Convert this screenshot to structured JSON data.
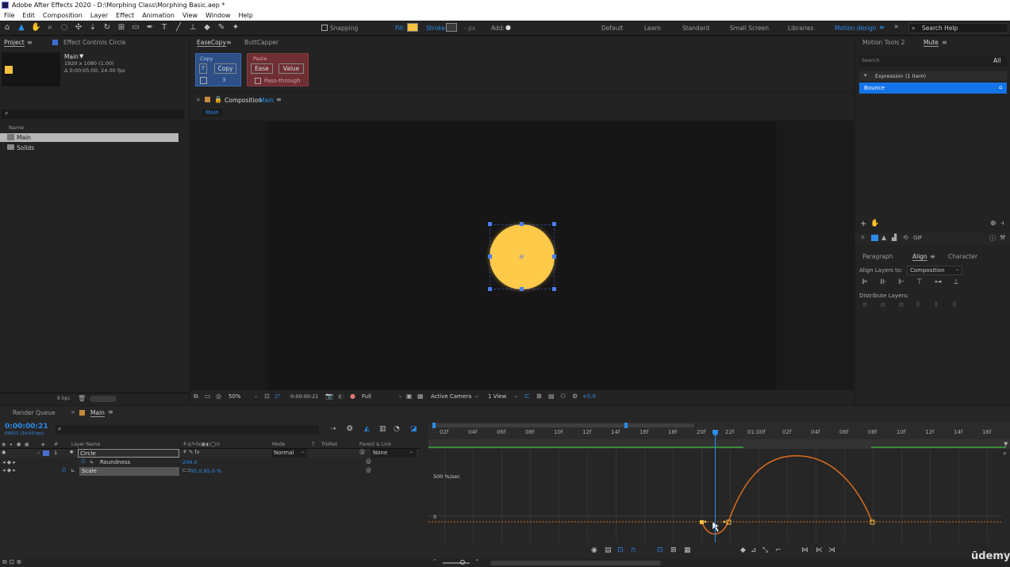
{
  "window": {
    "title": "Adobe After Effects 2020 - D:\\Morphing Class\\Morphing Basic.aep *"
  },
  "menu": [
    "File",
    "Edit",
    "Composition",
    "Layer",
    "Effect",
    "Animation",
    "View",
    "Window",
    "Help"
  ],
  "toolbar": {
    "snapping_label": "Snapping",
    "fill_label": "Fill:",
    "stroke_label": "Stroke:",
    "px_label": "- px",
    "add_label": "Add:",
    "fill_color": "#f5c141",
    "workspaces": [
      "Default",
      "Learn",
      "Standard",
      "Small Screen",
      "Libraries",
      "Motion design"
    ],
    "active_workspace": "Motion design",
    "search_help": "Search Help"
  },
  "project_panel": {
    "tab_project": "Project",
    "tab_effect_controls": "Effect Controls Circle",
    "comp_name": "Main",
    "comp_info_1": "1920 x 1080 (1.00)",
    "comp_info_2": "Δ 0:00:05:00, 24.00 fps",
    "col_name": "Name",
    "items": [
      "Main",
      "Solids"
    ],
    "bpc": "8 bpc"
  },
  "easecopy": {
    "tab_easecopy": "EaseCopy",
    "tab_buttcapper": "ButtCapper",
    "copy_group": "Copy",
    "copy_btn": "Copy",
    "help_btn": "?",
    "count": "3",
    "paste_group": "Paste",
    "ease_btn": "Ease",
    "value_btn": "Value",
    "pass_through": "Pass-through"
  },
  "composition": {
    "tab_label": "Composition",
    "tab_comp_name": "Main",
    "sub_tab": "Main",
    "circle_color": "#ffc94a",
    "zoom": "50%",
    "timecode": "0:00:00:21",
    "resolution": "Full",
    "camera": "Active Camera",
    "views": "1 View",
    "exposure": "+0.0"
  },
  "right_panel": {
    "tab_motion_tools": "Motion Tools 2",
    "tab_mute": "Mute",
    "search_placeholder": "Search",
    "all_label": "All",
    "expression_group": "Expression",
    "expression_count": "(1 Item)",
    "selected_item": "Bounce",
    "gif_label": "GIF",
    "tab_paragraph": "Paragraph",
    "tab_align": "Align",
    "tab_character": "Character",
    "align_layers_to": "Align Layers to:",
    "align_target": "Composition",
    "distribute_layers": "Distribute Layers:"
  },
  "timeline": {
    "tab_render_queue": "Render Queue",
    "tab_main": "Main",
    "timecode": "0:00:00:21",
    "timecode_sub": "00021 (24.00 fps)",
    "col_layer_name": "Layer Name",
    "col_mode": "Mode",
    "col_t": "T",
    "col_trkmat": "TrkMat",
    "col_parent": "Parent & Link",
    "layer_number": "1",
    "layer_name": "Circle",
    "layer_mode": "Normal",
    "layer_parent": "None",
    "prop_roundness": "Roundness",
    "prop_roundness_value": "204.0",
    "prop_scale": "Scale",
    "prop_scale_value": "95.0,95.0 %",
    "graph_label_top": "500 %/sec",
    "graph_label_zero": "0",
    "ticks": [
      "02f",
      "04f",
      "06f",
      "08f",
      "10f",
      "12f",
      "14f",
      "16f",
      "18f",
      "20f",
      "22f",
      "01:00f",
      "02f",
      "04f",
      "06f",
      "08f",
      "10f",
      "12f",
      "14f",
      "16f"
    ],
    "curve_color": "#d2691e",
    "udemy": "ūdemy"
  }
}
